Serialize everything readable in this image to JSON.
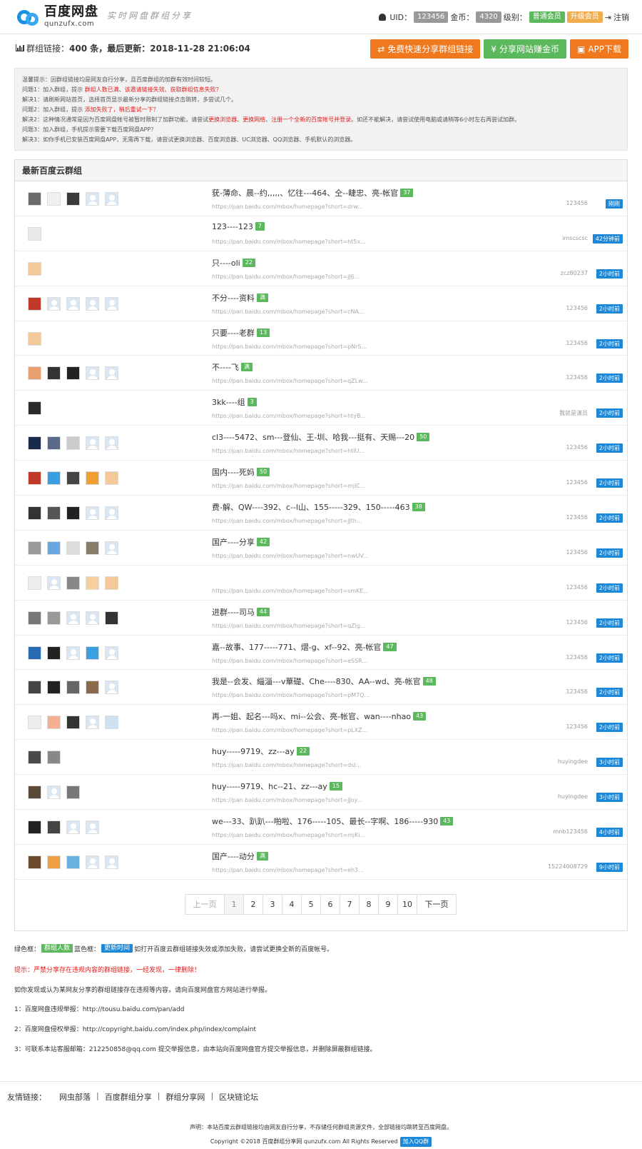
{
  "header": {
    "logo_title": "百度网盘",
    "logo_sub": "qunzufx.com",
    "slogan": "实时网盘群组分享",
    "uid_label": "UID：",
    "uid_value": "123456",
    "coin_label": "金币：",
    "coin_value": "4320",
    "level_label": "级别：",
    "level_value": "普通会员",
    "upgrade_label": "升级会员",
    "logout_label": "注销"
  },
  "stats": {
    "label": "群组链接：",
    "count": "400",
    "text_mid": " 条，最后更新：",
    "updated": "2018-11-28 21:06:04"
  },
  "actions": {
    "share_fast": "免费快速分享群组链接",
    "earn_coins": "分享网站赚金币",
    "app_download": "APP下载"
  },
  "notice": {
    "intro": "温馨提示：因群组链接均是网友自行分享，且百度群组的加群有效时间较短。",
    "q1_prefix": "问题1：加入群组，提示 ",
    "q1_red": "群组人数已满、该邀请链接失效、获取群组信息失败？",
    "a1": "解决1：请刷新网站首页，选择首页显示最新分享的群组链接点击跳转，多尝试几个。",
    "q2_prefix": "问题2：加入群组，提示 ",
    "q2_red": "添加失败了，稍后重试一下？",
    "a2_prefix": "解决2：这种情况通常是因为百度网盘帐号被暂时限制了加群功能，请尝试",
    "a2_red1": "更换浏览器",
    "a2_mid1": "、",
    "a2_red2": "更换网络",
    "a2_mid2": "、",
    "a2_red3": "注册一个全新的百度帐号并登录",
    "a2_suffix": "。如还不能解决，请尝试使用电脑或请稍等6小时左右再尝试加群。",
    "q3": "问题3：加入群组，手机提示需要下载百度网盘APP？",
    "a3": "解决3：如你手机已安装百度网盘APP，无需再下载，请尝试更换浏览器、百度浏览器、UC浏览器、QQ浏览器、手机默认的浏览器。"
  },
  "panel_title": "最新百度云群组",
  "groups": [
    {
      "title": "莸-薄命、晨--约,,,,,、忆往---464、仝--睫忠、亮-帐官",
      "badge": "37",
      "url": "https://pan.baidu.com/mbox/homepage?short=drw...",
      "user": "123456",
      "time": "刚刚"
    },
    {
      "title": "123----123",
      "badge": "7",
      "url": "https://pan.baidu.com/mbox/homepage?short=ht5x...",
      "user": "imscscsc",
      "time": "42分钟前"
    },
    {
      "title": "只----oli",
      "badge": "22",
      "url": "https://pan.baidu.com/mbox/homepage?short=jJ6...",
      "user": "zcz80237",
      "time": "2小时前"
    },
    {
      "title": "不分----资料",
      "badge": "满",
      "url": "https://pan.baidu.com/mbox/homepage?short=cNA...",
      "user": "123456",
      "time": "2小时前"
    },
    {
      "title": "只要----老群",
      "badge": "13",
      "url": "https://pan.baidu.com/mbox/homepage?short=pNrS...",
      "user": "123456",
      "time": "2小时前"
    },
    {
      "title": "不----飞",
      "badge": "满",
      "url": "https://pan.baidu.com/mbox/homepage?short=qZLw...",
      "user": "123456",
      "time": "2小时前"
    },
    {
      "title": "3kk----组",
      "badge": "3",
      "url": "https://pan.baidu.com/mbox/homepage?short=htyB...",
      "user": "我就是演员",
      "time": "2小时前"
    },
    {
      "title": "cl3----5472、sm---登仙、王-圳、哈我---挺有、天赐---20",
      "badge": "50",
      "url": "https://pan.baidu.com/mbox/homepage?short=htlU...",
      "user": "123456",
      "time": "2小时前"
    },
    {
      "title": "国内----死妈",
      "badge": "50",
      "url": "https://pan.baidu.com/mbox/homepage?short=mjlC...",
      "user": "123456",
      "time": "2小时前"
    },
    {
      "title": "费-解、QW----392、c--l山、155-----329、150-----463",
      "badge": "38",
      "url": "https://pan.baidu.com/mbox/homepage?short=jJth...",
      "user": "123456",
      "time": "2小时前"
    },
    {
      "title": "国产----分享",
      "badge": "42",
      "url": "https://pan.baidu.com/mbox/homepage?short=nwUV...",
      "user": "123456",
      "time": "2小时前"
    },
    {
      "title": "",
      "badge": "",
      "url": "https://pan.baidu.com/mbox/homepage?short=smKE...",
      "user": "123456",
      "time": "2小时前"
    },
    {
      "title": "进群----司马",
      "badge": "44",
      "url": "https://pan.baidu.com/mbox/homepage?short=qZig...",
      "user": "123456",
      "time": "2小时前"
    },
    {
      "title": "嘉--故事、177-----771、熠-g、xf--92、亮-帐官",
      "badge": "47",
      "url": "https://pan.baidu.com/mbox/homepage?short=eSSR...",
      "user": "123456",
      "time": "2小时前"
    },
    {
      "title": "我是--会发、緇淄---v華礎、Che----830、AA--wd、亮-帐官",
      "badge": "48",
      "url": "https://pan.baidu.com/mbox/homepage?short=pM7Q...",
      "user": "123456",
      "time": "2小时前"
    },
    {
      "title": "再-一姐、起名---吗x、mi--公会、亮-帐官、wan----nhao",
      "badge": "43",
      "url": "https://pan.baidu.com/mbox/homepage?short=pLXZ...",
      "user": "123456",
      "time": "2小时前"
    },
    {
      "title": "huy-----9719、zz---ay",
      "badge": "22",
      "url": "https://pan.baidu.com/mbox/homepage?short=dsl...",
      "user": "huyingdee",
      "time": "3小时前"
    },
    {
      "title": "huy-----9719、hc--21、zz---ay",
      "badge": "15",
      "url": "https://pan.baidu.com/mbox/homepage?short=jJoy...",
      "user": "huyingdee",
      "time": "3小时前"
    },
    {
      "title": "we---33、趴趴---啪啦、176-----105、最长--字啊、186-----930",
      "badge": "43",
      "url": "https://pan.baidu.com/mbox/homepage?short=mjKi...",
      "user": "mnb123456",
      "time": "4小时前"
    },
    {
      "title": "国产----动分",
      "badge": "满",
      "url": "https://pan.baidu.com/mbox/homepage?short=eh3...",
      "user": "15224008729",
      "time": "9小时前"
    }
  ],
  "avatars": [
    [
      "#6b6b6b",
      "#f0f0f0",
      "#3a3a3a",
      "e",
      "e"
    ],
    [
      "#e8e8e8"
    ],
    [
      "#f4c99a"
    ],
    [
      "#c0392b",
      "e",
      "e",
      "e",
      "e"
    ],
    [
      "#f4c99a"
    ],
    [
      "#e8a070",
      "#333",
      "#222",
      "e",
      "e"
    ],
    [
      "#2a2a2a"
    ],
    [
      "#1a2a4a",
      "#5a6a8a",
      "#ccc",
      "e",
      "e"
    ],
    [
      "#c0392b",
      "#3a9ee0",
      "#444",
      "#f0a030",
      "#f4c99a"
    ],
    [
      "#333",
      "#555",
      "#222",
      "e",
      "e"
    ],
    [
      "#999",
      "#6aa6e0",
      "#ddd",
      "#8a7a6a",
      "e"
    ],
    [
      "#eee",
      "e",
      "#888",
      "#f4d0a0",
      "#f4c99a"
    ],
    [
      "#777",
      "#999",
      "e",
      "e",
      "#333"
    ],
    [
      "#2a6ab0",
      "#222",
      "e",
      "#3aa0e0",
      "e"
    ],
    [
      "#444",
      "#222",
      "#666",
      "#8a6a4a",
      "e"
    ],
    [
      "#eee",
      "#f4b090",
      "#333",
      "e",
      "#cfe0f0"
    ],
    [
      "#4a4a4a",
      "#888"
    ],
    [
      "#5a4a3a",
      "e",
      "#777"
    ],
    [
      "#222",
      "#444",
      "e",
      "e"
    ],
    [
      "#6a4a2a",
      "#f0a040",
      "#6ab0e0",
      "e",
      "e"
    ]
  ],
  "pager": {
    "prev": "上一页",
    "pages": [
      "1",
      "2",
      "3",
      "4",
      "5",
      "6",
      "7",
      "8",
      "9",
      "10"
    ],
    "next": "下一页",
    "current": "1"
  },
  "legend": {
    "green_label": "绿色框：",
    "green_tag": "群组人数",
    "blue_label": "蓝色框：",
    "blue_tag": "更新时间",
    "text": "如打开百度云群组链接失效或添加失败，请尝试更换全新的百度帐号。"
  },
  "warning": "提示：严禁分享存在违规内容的群组链接，一经发现，一律删除！",
  "report_intro": "如你发现或认为某网友分享的群组链接存在违规等内容，请向百度网盘官方网站进行举报。",
  "report_lines": [
    "1：百度网盘违规举报：http://tousu.baidu.com/pan/add",
    "2：百度网盘侵权举报：http://copyright.baidu.com/index.php/index/complaint",
    "3：可联系本站客服邮箱：212250858@qq.com 提交举报信息，由本站向百度网盘官方提交举报信息，并删除屏蔽群组链接。"
  ],
  "friends": {
    "title": "友情链接：",
    "links": [
      "网虫部落",
      "百度群组分享",
      "群组分享网",
      "区块链论坛"
    ]
  },
  "footer": {
    "statement": "声明：本站百度云群组链接均由网友自行分享，不存储任何群组资源文件，全部链接均跳转至百度网盘。",
    "copyright": "Copyright ©2018 百度群组分享网 qunzufx.com All Rights Reserved",
    "qq_label": "加入QQ群"
  }
}
